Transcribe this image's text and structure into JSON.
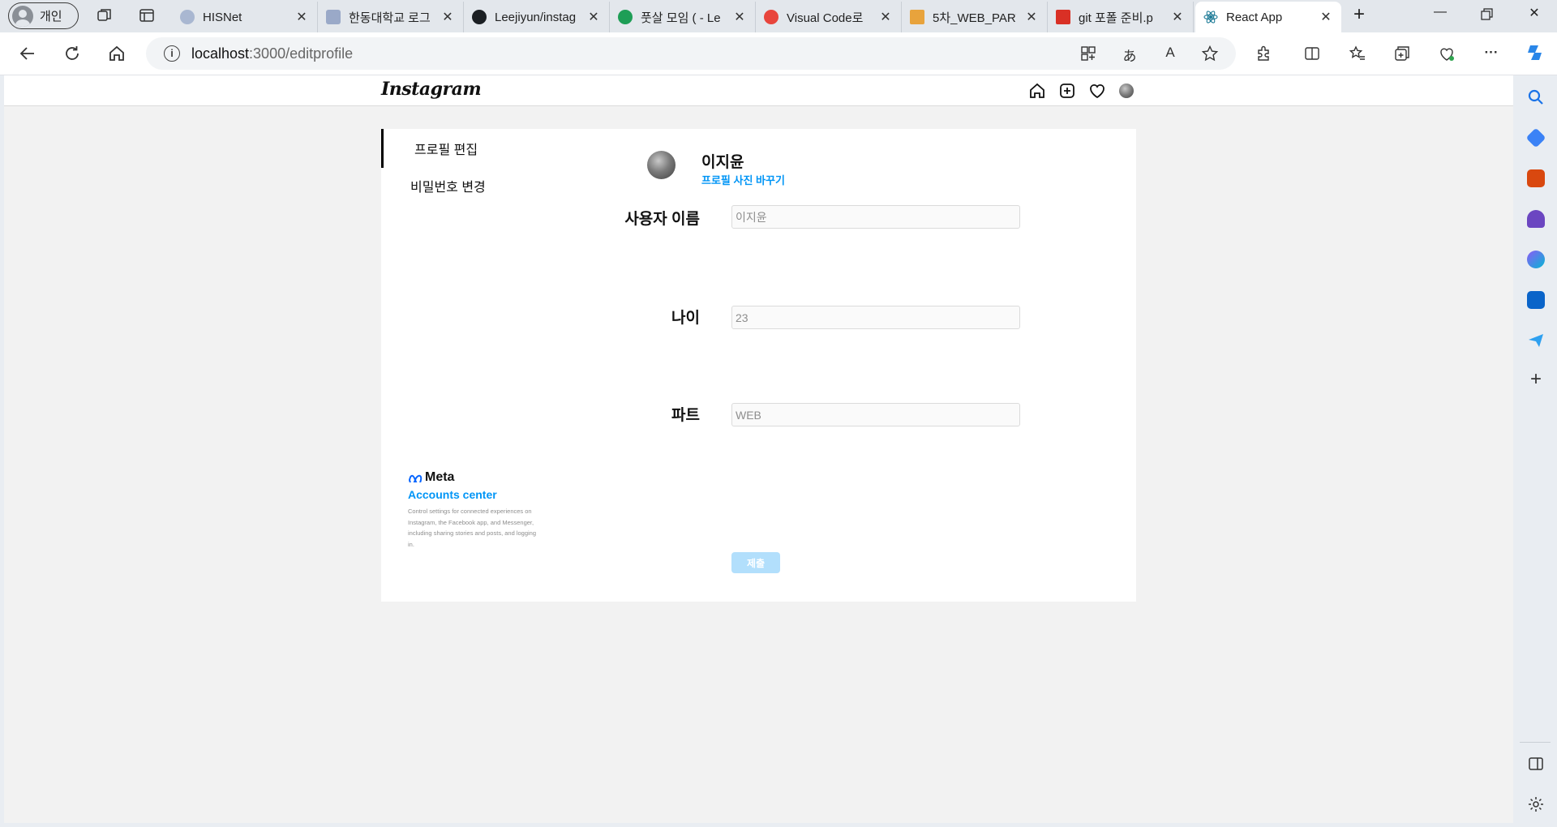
{
  "browser": {
    "profile_label": "개인",
    "tabs": [
      {
        "title": "HISNet",
        "favicon_color": "#a9b7d1"
      },
      {
        "title": "한동대학교 로그",
        "favicon_color": "#9aa9c8"
      },
      {
        "title": "Leejiyun/instag",
        "favicon_color": "#1b1f23"
      },
      {
        "title": "풋살 모임 ( - Le",
        "favicon_color": "#1e9e56"
      },
      {
        "title": "Visual Code로",
        "favicon_color": "#e8453c"
      },
      {
        "title": "5차_WEB_PART",
        "favicon_color": "#e8a33c"
      },
      {
        "title": "git 포폴 준비.p",
        "favicon_color": "#d93025"
      },
      {
        "title": "React App",
        "favicon_color": "#61dafb"
      }
    ],
    "active_tab_index": 7,
    "url_host": "localhost",
    "url_path": ":3000/editprofile"
  },
  "ig": {
    "logo_text": "Instagram",
    "side_menu": {
      "edit_profile": "프로필 편집",
      "change_password": "비밀번호 변경"
    },
    "meta": {
      "logo_text": "Meta",
      "accounts_center": "Accounts center",
      "description": "Control settings for connected experiences on Instagram, the Facebook app, and Messenger, including sharing stories and posts, and logging in."
    },
    "profile": {
      "name": "이지윤",
      "change_photo": "프로필 사진 바꾸기"
    },
    "form": {
      "username_label": "사용자 이름",
      "username_placeholder": "이지윤",
      "age_label": "나이",
      "age_placeholder": "23",
      "part_label": "파트",
      "part_placeholder": "WEB",
      "submit_label": "제출"
    }
  },
  "colors": {
    "accent_blue": "#0095f6",
    "submit_disabled": "#b2dffc"
  }
}
